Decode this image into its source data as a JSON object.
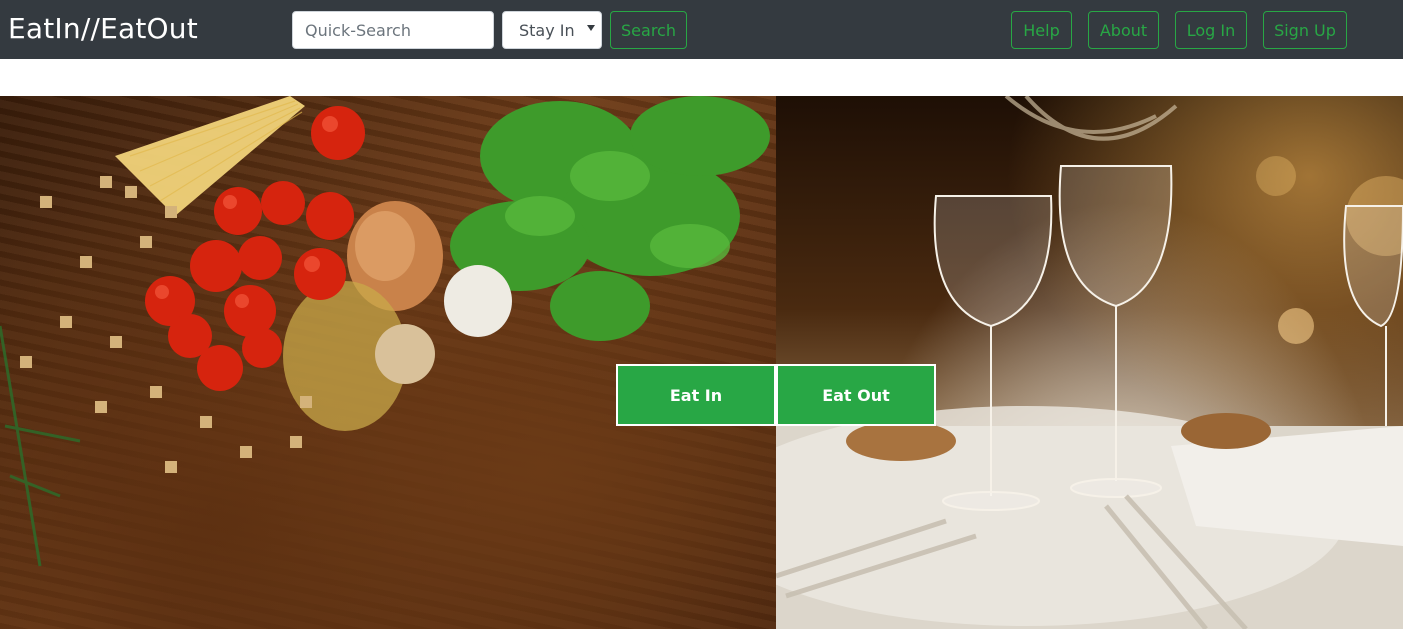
{
  "header": {
    "brand": "EatIn//EatOut",
    "search": {
      "placeholder": "Quick-Search",
      "value": ""
    },
    "mode_select": {
      "selected": "Stay In"
    },
    "search_button": "Search",
    "nav": {
      "help": "Help",
      "about": "About",
      "login": "Log In",
      "signup": "Sign Up"
    }
  },
  "hero": {
    "eat_in_button": "Eat In",
    "eat_out_button": "Eat Out"
  },
  "colors": {
    "navbar_bg": "#343a40",
    "accent_green": "#28a745",
    "white": "#ffffff"
  },
  "icons": [
    "select-caret-icon"
  ]
}
